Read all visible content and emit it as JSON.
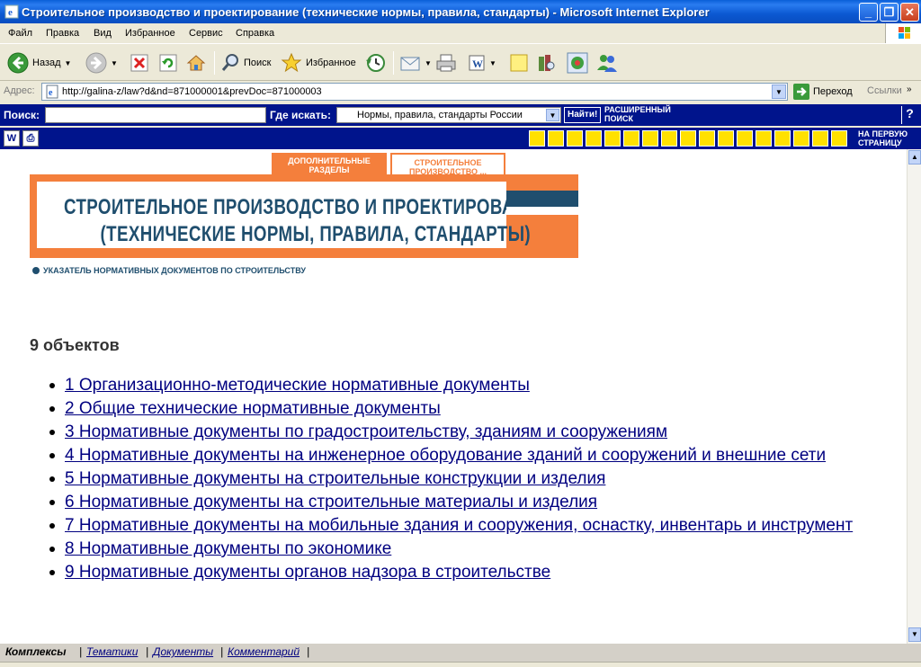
{
  "window": {
    "title": "Строительное производство и проектирование (технические нормы, правила, стандарты) - Microsoft Internet Explorer"
  },
  "menu": [
    "Файл",
    "Правка",
    "Вид",
    "Избранное",
    "Сервис",
    "Справка"
  ],
  "toolbar": {
    "back_label": "Назад",
    "search_label": "Поиск",
    "favorites_label": "Избранное"
  },
  "address": {
    "label": "Адрес:",
    "url": "http://galina-z/law?d&nd=871000001&prevDoc=871000003",
    "go_label": "Переход",
    "links_label": "Ссылки"
  },
  "site_search": {
    "search_label": "Поиск:",
    "search_value": "",
    "where_label": "Где искать:",
    "where_value": "Нормы, правила, стандарты России",
    "find_button": "Найти!",
    "advanced_line1": "РАСШИРЕННЫЙ",
    "advanced_line2": "ПОИСК",
    "help": "?"
  },
  "iconbar": {
    "first_page_line1": "НА ПЕРВУЮ",
    "first_page_line2": "СТРАНИЦУ"
  },
  "tabs": {
    "extra_line1": "ДОПОЛНИТЕЛЬНЫЕ",
    "extra_line2": "РАЗДЕЛЫ",
    "building_line1": "СТРОИТЕЛЬНОЕ",
    "building_line2": "ПРОИЗВОДСТВО ..."
  },
  "banner": {
    "title_line1": "СТРОИТЕЛЬНОЕ ПРОИЗВОДСТВО И ПРОЕКТИРОВАНИЕ",
    "title_line2": "(ТЕХНИЧЕСКИЕ НОРМЫ, ПРАВИЛА, СТАНДАРТЫ)",
    "index_link": "УКАЗАТЕЛЬ НОРМАТИВНЫХ ДОКУМЕНТОВ ПО СТРОИТЕЛЬСТВУ"
  },
  "content": {
    "count": "9 объектов",
    "items": [
      "1 Организационно-методические нормативные документы",
      "2 Общие технические нормативные документы",
      "3 Нормативные документы по градостроительству, зданиям и сооружениям",
      "4 Нормативные документы на инженерное оборудование зданий и сооружений и внешние сети",
      "5 Нормативные документы на строительные конструкции и изделия",
      "6 Нормативные документы на строительные материалы и изделия",
      "7 Нормативные документы на мобильные здания и сооружения, оснастку, инвентарь и инструмент",
      "8 Нормативные документы по экономике",
      "9 Нормативные документы органов надзора в строительстве"
    ]
  },
  "bottom_tabs": [
    "Комплексы",
    "Тематики",
    "Документы",
    "Комментарий"
  ],
  "colors": {
    "site_blue": "#00148c",
    "banner_orange": "#f47f3c",
    "banner_text": "#1f4e6e",
    "link": "#000080"
  }
}
